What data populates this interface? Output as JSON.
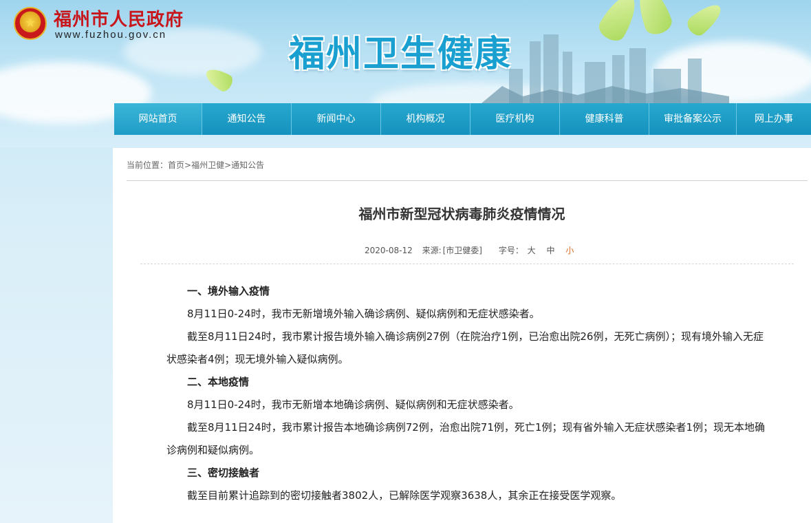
{
  "header": {
    "gov_name": "福州市人民政府",
    "gov_url": "www.fuzhou.gov.cn",
    "site_title": "福州卫生健康"
  },
  "nav": [
    {
      "label": "网站首页"
    },
    {
      "label": "通知公告"
    },
    {
      "label": "新闻中心"
    },
    {
      "label": "机构概况"
    },
    {
      "label": "医疗机构"
    },
    {
      "label": "健康科普"
    },
    {
      "label": "审批备案公示"
    },
    {
      "label": "网上办事"
    }
  ],
  "breadcrumb": {
    "prefix": "当前位置：",
    "items": [
      "首页",
      "福州卫健",
      "通知公告"
    ],
    "separator": ">"
  },
  "article": {
    "title": "福州市新型冠状病毒肺炎疫情情况",
    "date": "2020-08-12",
    "source_label": "来源:",
    "source": "[市卫健委]",
    "font_label": "字号：",
    "font_sizes": [
      "大",
      "中",
      "小"
    ],
    "active_font_size": "小",
    "colors": {
      "active_font": "#e06b1f",
      "nav": "#1591bd",
      "title": "#1aa0d0",
      "gov_name": "#c8161d"
    },
    "paragraphs": [
      {
        "type": "heading",
        "text": "一、境外输入疫情"
      },
      {
        "type": "text",
        "text": "8月11日0-24时，我市无新增境外输入确诊病例、疑似病例和无症状感染者。"
      },
      {
        "type": "text",
        "text": "截至8月11日24时，我市累计报告境外输入确诊病例27例（在院治疗1例，已治愈出院26例，无死亡病例）；现有境外输入无症状感染者4例；现无境外输入疑似病例。"
      },
      {
        "type": "heading",
        "text": "二、本地疫情"
      },
      {
        "type": "text",
        "text": "8月11日0-24时，我市无新增本地确诊病例、疑似病例和无症状感染者。"
      },
      {
        "type": "text",
        "text": "截至8月11日24时，我市累计报告本地确诊病例72例，治愈出院71例，死亡1例；现有省外输入无症状感染者1例；现无本地确诊病例和疑似病例。"
      },
      {
        "type": "heading",
        "text": "三、密切接触者"
      },
      {
        "type": "text",
        "text": "截至目前累计追踪到的密切接触者3802人，已解除医学观察3638人，其余正在接受医学观察。"
      }
    ]
  }
}
